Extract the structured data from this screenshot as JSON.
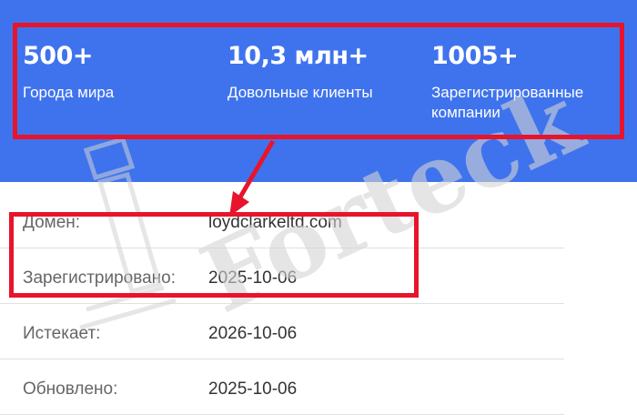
{
  "stats": [
    {
      "value": "500+",
      "label": "Города мира"
    },
    {
      "value": "10,3 млн+",
      "label": "Довольные клиенты"
    },
    {
      "value": "1005+",
      "label": "Зарегистрированные компании"
    }
  ],
  "whois": [
    {
      "key": "Домен:",
      "value": "loydclarkeltd.com"
    },
    {
      "key": "Зарегистрировано:",
      "value": "2025-10-06"
    },
    {
      "key": "Истекает:",
      "value": "2026-10-06"
    },
    {
      "key": "Обновлено:",
      "value": "2025-10-06"
    }
  ],
  "watermark": {
    "text": "Forteck"
  },
  "colors": {
    "banner": "#3f73ee",
    "highlight": "#e8142b"
  }
}
